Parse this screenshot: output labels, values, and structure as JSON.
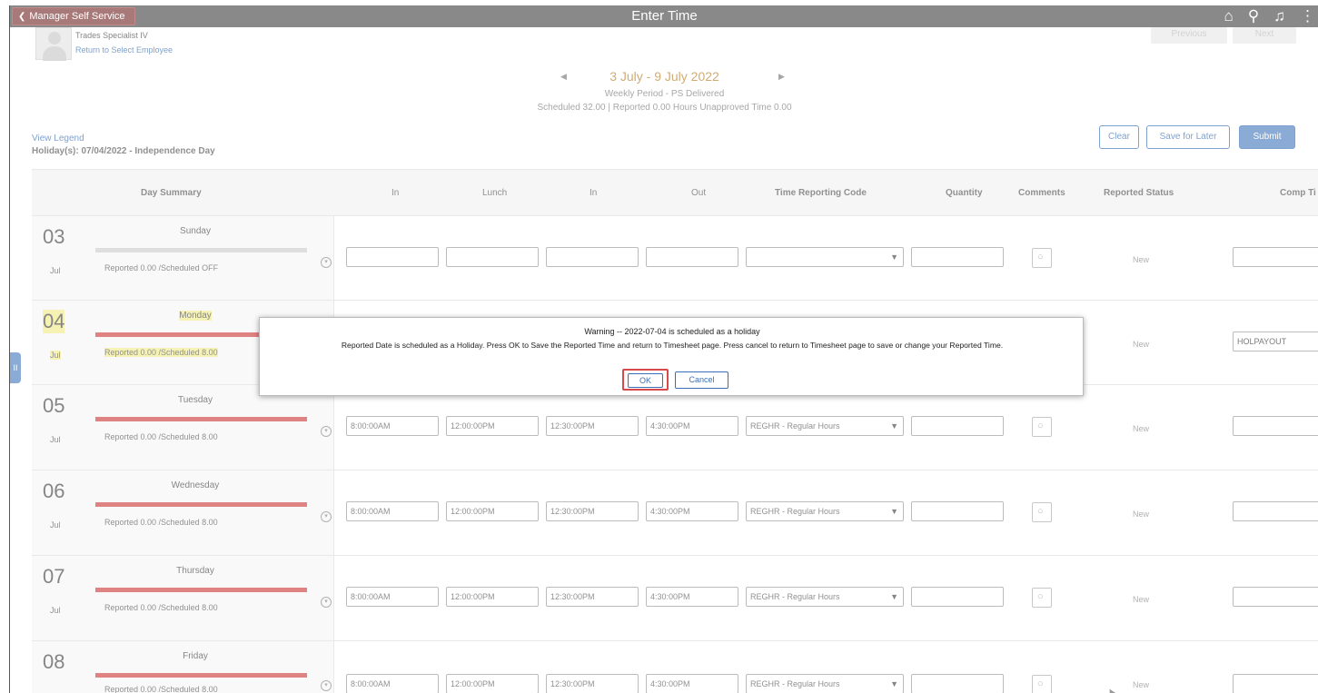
{
  "header": {
    "back_label": "Manager Self Service",
    "title": "Enter Time",
    "icons": [
      "home-icon",
      "search-icon",
      "bell-icon",
      "more-icon"
    ],
    "previous_label": "Previous",
    "next_label": "Next"
  },
  "employee": {
    "job_title": "Trades Specialist IV",
    "return_link": "Return to Select Employee"
  },
  "period": {
    "range": "3 July - 9 July 2022",
    "type": "Weekly Period - PS Delivered",
    "stats": "Scheduled  32.00  |  Reported  0.00 Hours  Unapproved Time  0.00"
  },
  "legend_link": "View Legend",
  "holiday_note": "Holiday(s): 07/04/2022 - Independence Day",
  "actions": {
    "clear": "Clear",
    "save_later": "Save for Later",
    "submit": "Submit"
  },
  "columns": {
    "day_summary": "Day Summary",
    "in1": "In",
    "lunch": "Lunch",
    "in2": "In",
    "out": "Out",
    "trc": "Time Reporting Code",
    "quantity": "Quantity",
    "comments": "Comments",
    "status": "Reported Status",
    "comp": "Comp Ti"
  },
  "days": [
    {
      "num": "03",
      "mon": "Jul",
      "name": "Sunday",
      "rep": "Reported 0.00 /Scheduled OFF",
      "in1": "",
      "lunch": "",
      "in2": "",
      "out": "",
      "trc": "",
      "status": "New",
      "comp": ""
    },
    {
      "num": "04",
      "mon": "Jul",
      "name": "Monday",
      "rep": "Reported 0.00 /Scheduled 8.00",
      "in1": "",
      "lunch": "",
      "in2": "",
      "out": "",
      "trc": "",
      "status": "New",
      "comp": "HOLPAYOUT"
    },
    {
      "num": "05",
      "mon": "Jul",
      "name": "Tuesday",
      "rep": "Reported 0.00 /Scheduled 8.00",
      "in1": "8:00:00AM",
      "lunch": "12:00:00PM",
      "in2": "12:30:00PM",
      "out": "4:30:00PM",
      "trc": "REGHR - Regular Hours",
      "status": "New",
      "comp": ""
    },
    {
      "num": "06",
      "mon": "Jul",
      "name": "Wednesday",
      "rep": "Reported 0.00 /Scheduled 8.00",
      "in1": "8:00:00AM",
      "lunch": "12:00:00PM",
      "in2": "12:30:00PM",
      "out": "4:30:00PM",
      "trc": "REGHR - Regular Hours",
      "status": "New",
      "comp": ""
    },
    {
      "num": "07",
      "mon": "Jul",
      "name": "Thursday",
      "rep": "Reported 0.00 /Scheduled 8.00",
      "in1": "8:00:00AM",
      "lunch": "12:00:00PM",
      "in2": "12:30:00PM",
      "out": "4:30:00PM",
      "trc": "REGHR - Regular Hours",
      "status": "New",
      "comp": ""
    },
    {
      "num": "08",
      "mon": "Jul",
      "name": "Friday",
      "rep": "Reported 0.00 /Scheduled 8.00",
      "in1": "8:00:00AM",
      "lunch": "12:00:00PM",
      "in2": "12:30:00PM",
      "out": "4:30:00PM",
      "trc": "REGHR - Regular Hours",
      "status": "New",
      "comp": ""
    }
  ],
  "modal": {
    "title": "Warning -- 2022-07-04 is scheduled as  a holiday",
    "message": "Reported Date is scheduled as a Holiday. Press OK to Save the Reported Time and return to Timesheet page. Press cancel to return to Timesheet page to save or change your Reported Time.",
    "ok": "OK",
    "cancel": "Cancel"
  },
  "colors": {
    "banner": "#4a4a4a",
    "back_button": "#7a3232",
    "accent": "#3a6fb5",
    "schedule_bar": "#cc4040",
    "holiday_highlight": "#f0eb8c",
    "ok_highlight": "#d84a4a"
  }
}
